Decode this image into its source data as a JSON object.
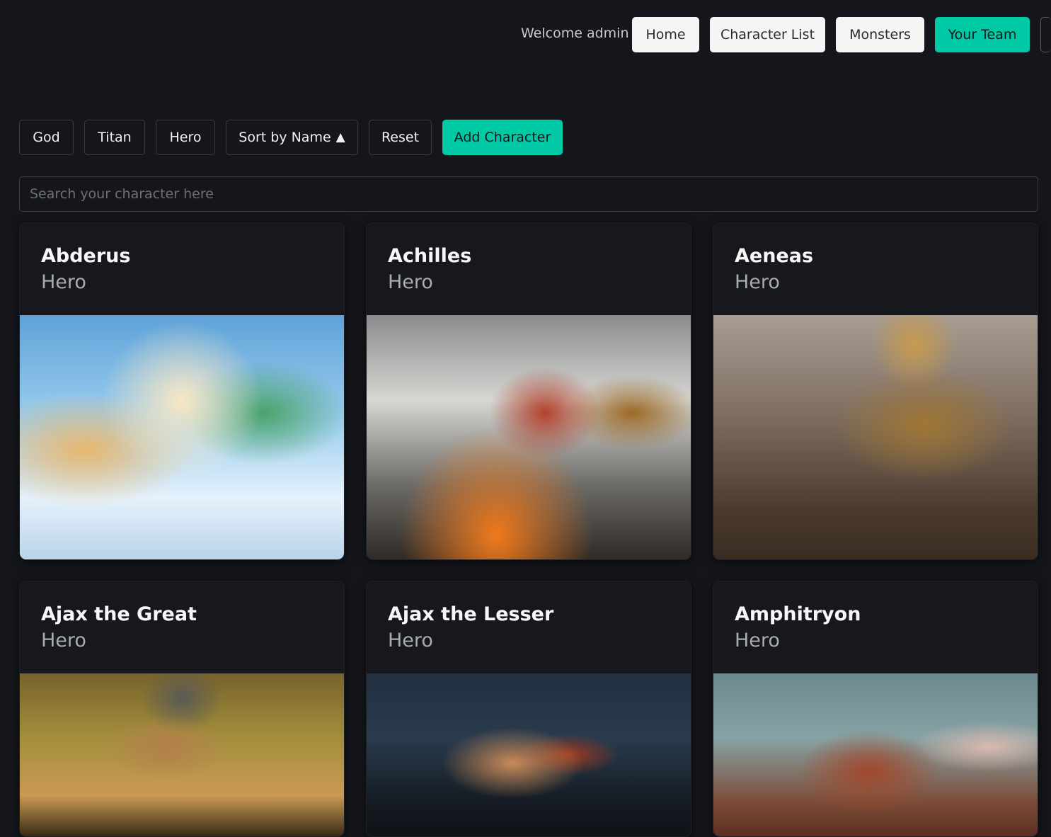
{
  "header": {
    "welcome": "Welcome admin",
    "nav": [
      {
        "label": "Home"
      },
      {
        "label": "Character List"
      },
      {
        "label": "Monsters"
      },
      {
        "label": "Your Team"
      }
    ]
  },
  "filters": {
    "god": "God",
    "titan": "Titan",
    "hero": "Hero",
    "sort": "Sort by Name",
    "sort_arrow": "▲",
    "reset": "Reset",
    "add": "Add Character"
  },
  "search": {
    "placeholder": "Search your character here",
    "value": ""
  },
  "cards": [
    {
      "name": "Abderus",
      "type": "Hero"
    },
    {
      "name": "Achilles",
      "type": "Hero"
    },
    {
      "name": "Aeneas",
      "type": "Hero"
    },
    {
      "name": "Ajax the Great",
      "type": "Hero"
    },
    {
      "name": "Ajax the Lesser",
      "type": "Hero"
    },
    {
      "name": "Amphitryon",
      "type": "Hero"
    }
  ],
  "colors": {
    "accent": "#00c9a6",
    "background": "#14161b",
    "card": "#16181d"
  }
}
